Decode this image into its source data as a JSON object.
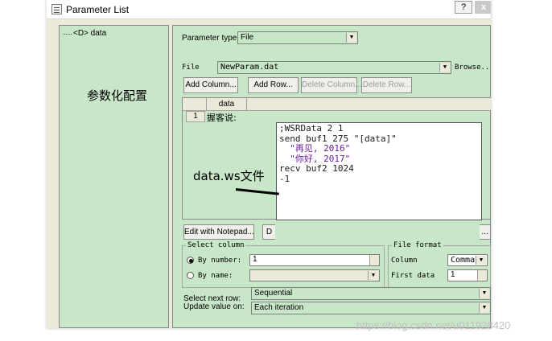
{
  "window": {
    "title": "Parameter List",
    "help_label": "?",
    "close_label": "x"
  },
  "tree": {
    "items": [
      {
        "label": "<D> data"
      }
    ]
  },
  "annotations": {
    "config": "参数化配置",
    "file_note": "data.ws文件"
  },
  "parameter_type": {
    "label": "Parameter type:",
    "value": "File"
  },
  "file": {
    "label": "File",
    "value": "NewParam.dat",
    "browse_label": "Browse..."
  },
  "buttons": {
    "add_column": "Add Column...",
    "add_row": "Add Row...",
    "delete_column": "Delete Column...",
    "delete_row": "Delete Row...",
    "edit_notepad": "Edit with Notepad...",
    "data_wizard_partial": "D",
    "hidden_partial": "..."
  },
  "grid": {
    "columns": [
      "data"
    ],
    "rows": [
      {
        "num": "1",
        "value": "握客说:"
      }
    ]
  },
  "editor": {
    "lines": [
      ";WSRData 2 1",
      "send buf1 275 \"[data]\"",
      "  \"再见, 2016\"",
      "  \"你好, 2017\"",
      "recv buf2 1024",
      "-1"
    ]
  },
  "select_column": {
    "legend": "Select column",
    "by_number_label": "By number:",
    "by_number_value": "1",
    "by_name_label": "By name:",
    "by_name_value": ""
  },
  "file_format": {
    "legend": "File format",
    "column_label": "Column",
    "column_value": "Comma",
    "first_data_label": "First data",
    "first_data_value": "1"
  },
  "next_row": {
    "label": "Select next row:",
    "value": "Sequential"
  },
  "update_value": {
    "label": "Update value on:",
    "value": "Each iteration"
  },
  "watermark": "https://blog.csdn.net/u011928420"
}
